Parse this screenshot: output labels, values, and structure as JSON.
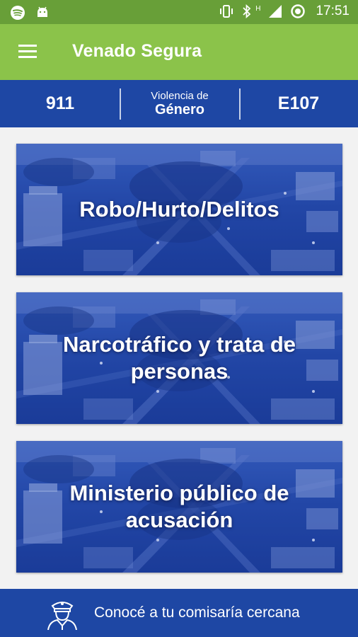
{
  "status_bar": {
    "icons": [
      "spotify-icon",
      "android-icon",
      "vibrate-icon",
      "bluetooth-icon",
      "signal-icon",
      "sync-icon"
    ],
    "network_label": "H",
    "time": "17:51"
  },
  "app_bar": {
    "menu_icon": "hamburger-menu-icon",
    "title": "Venado Segura",
    "background": "#8bc34a"
  },
  "emergency_bar": {
    "number_911": "911",
    "gender_small": "Violencia de",
    "gender_big": "Género",
    "number_e107": "E107",
    "background": "#1e47a4"
  },
  "cards": [
    {
      "label": "Robo/Hurto/Delitos"
    },
    {
      "label": "Narcotráfico y trata de personas"
    },
    {
      "label": "Ministerio público de acusación"
    }
  ],
  "bottom_bar": {
    "icon": "police-officer-icon",
    "label": "Conocé a tu comisaría cercana"
  }
}
